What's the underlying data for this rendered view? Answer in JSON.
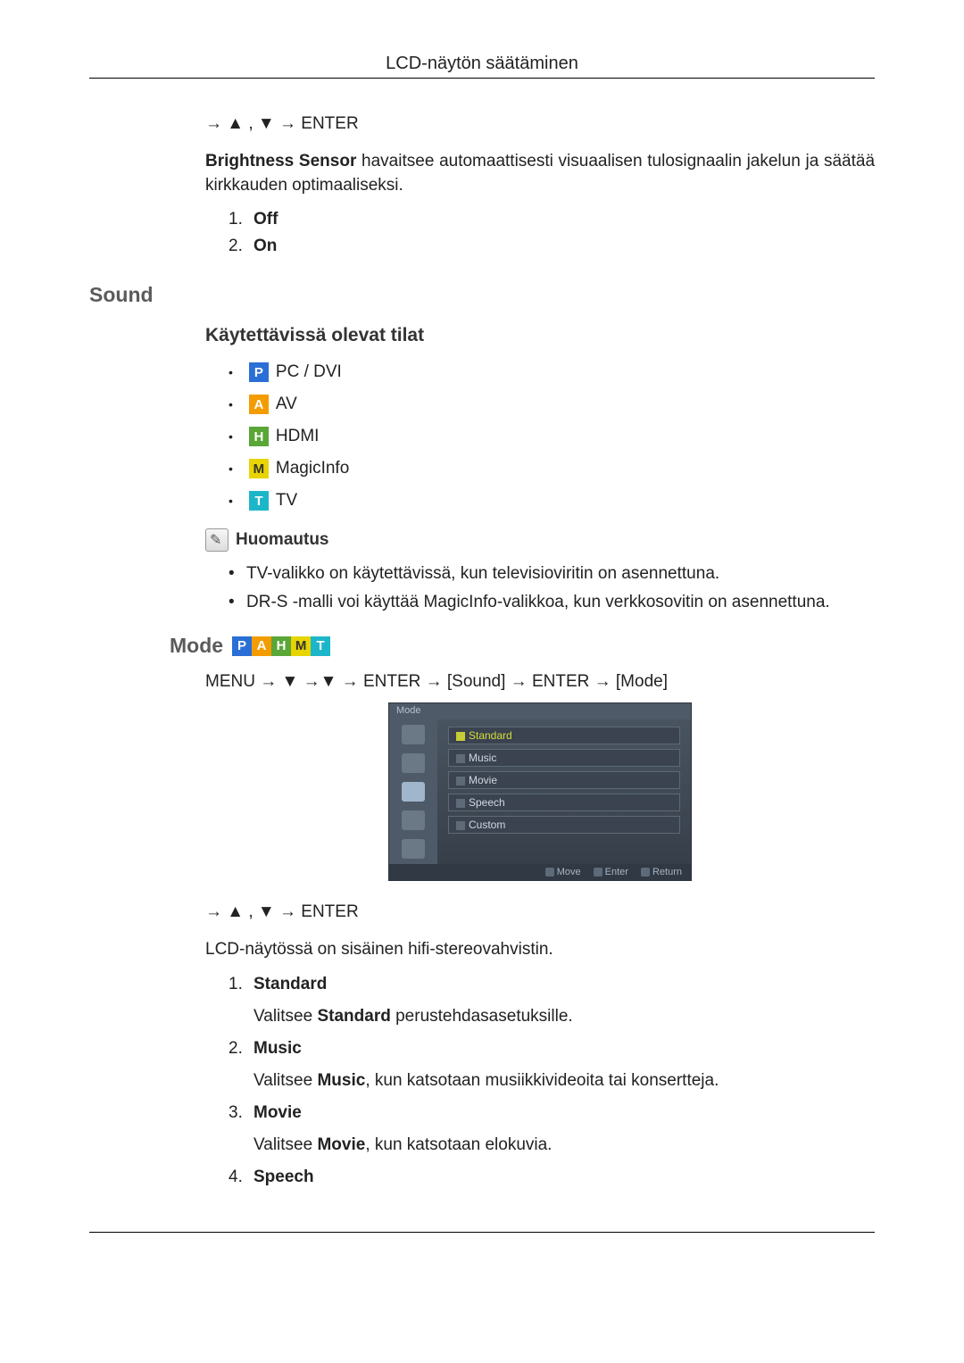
{
  "header": {
    "title": "LCD-näytön säätäminen"
  },
  "brightness": {
    "nav": "→ ▲ , ▼ → ENTER",
    "desc_strong": "Brightness Sensor",
    "desc_rest": " havaitsee automaattisesti visuaalisen tulosignaalin jakelun ja säätää kirkkauden optimaaliseksi.",
    "items": [
      {
        "num": "1.",
        "label": "Off"
      },
      {
        "num": "2.",
        "label": "On"
      }
    ]
  },
  "sound": {
    "heading": "Sound",
    "modes_heading": "Käytettävissä olevat tilat",
    "modes": [
      {
        "icon": "P",
        "cls": "icon-p",
        "label": "PC / DVI"
      },
      {
        "icon": "A",
        "cls": "icon-a",
        "label": "AV"
      },
      {
        "icon": "H",
        "cls": "icon-h",
        "label": "HDMI"
      },
      {
        "icon": "M",
        "cls": "icon-m",
        "label": "MagicInfo"
      },
      {
        "icon": "T",
        "cls": "icon-t",
        "label": "TV"
      }
    ],
    "note_label": "Huomautus",
    "notes": [
      "TV-valikko on käytettävissä, kun televisioviritin on asennettuna.",
      "DR-S -malli voi käyttää MagicInfo-valikkoa, kun verkkosovitin on asennettuna."
    ]
  },
  "mode": {
    "heading": "Mode",
    "path": "MENU → ▼ →▼ → ENTER → [Sound] → ENTER → [Mode]",
    "nav": "→ ▲ , ▼ → ENTER",
    "osd": {
      "title": "Mode",
      "items": [
        "Standard",
        "Music",
        "Movie",
        "Speech",
        "Custom"
      ],
      "footer": [
        "Move",
        "Enter",
        "Return"
      ]
    },
    "intro": "LCD-näytössä on sisäinen hifi-stereovahvistin.",
    "list": [
      {
        "num": "1.",
        "title": "Standard",
        "desc_pre": "Valitsee ",
        "desc_bold": "Standard",
        "desc_post": " perustehdasasetuksille."
      },
      {
        "num": "2.",
        "title": "Music",
        "desc_pre": "Valitsee ",
        "desc_bold": "Music",
        "desc_post": ", kun katsotaan musiikkivideoita tai konsertteja."
      },
      {
        "num": "3.",
        "title": "Movie",
        "desc_pre": "Valitsee ",
        "desc_bold": "Movie",
        "desc_post": ", kun katsotaan elokuvia."
      },
      {
        "num": "4.",
        "title": "Speech"
      }
    ]
  }
}
